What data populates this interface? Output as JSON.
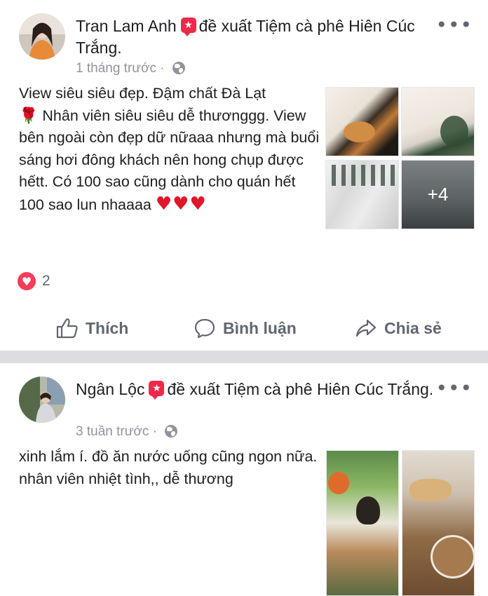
{
  "posts": [
    {
      "author": "Tran Lam Anh",
      "action_text": "đề xuất Tiệm cà phê Hiên Cúc Trắng.",
      "time": "1 tháng trước",
      "separator": "·",
      "body_line1": "View siêu siêu đẹp. Đậm chất Đà Lạt",
      "rose_emoji": "🌹",
      "body_line2": " Nhân viên siêu siêu dễ thươnggg. View bên ngoài còn đẹp dữ nữaaa nhưng mà buổi sáng hơi đông khách nên hong chụp được hếtt. Có 100 sao cũng dành cho quán hết 100 sao lun nhaaaa ",
      "hearts": "♥♥♥",
      "more_photos": "+4",
      "reaction_count": "2",
      "actions": {
        "like": "Thích",
        "comment": "Bình luận",
        "share": "Chia sẻ"
      }
    },
    {
      "author": "Ngân Lộc",
      "action_text": "đề xuất Tiệm cà phê Hiên Cúc Trắng.",
      "time": "3 tuần trước",
      "separator": "·",
      "body": "xinh lắm í. đồ ăn nước uống cũng ngon nữa. nhân viên nhiệt tình,, dễ thương"
    }
  ],
  "more_icon": "•••",
  "icons": {
    "recommend": "recommend-badge-icon",
    "globe": "globe-icon",
    "like": "thumbs-up-icon",
    "comment": "comment-bubble-icon",
    "share": "share-arrow-icon",
    "heart_reaction": "heart-reaction-icon"
  },
  "colors": {
    "recommend_badge": "#f02849",
    "heart": "#f33e58",
    "secondary_text": "#606770",
    "meta_text": "#90949c",
    "separator": "#dcdde0"
  }
}
